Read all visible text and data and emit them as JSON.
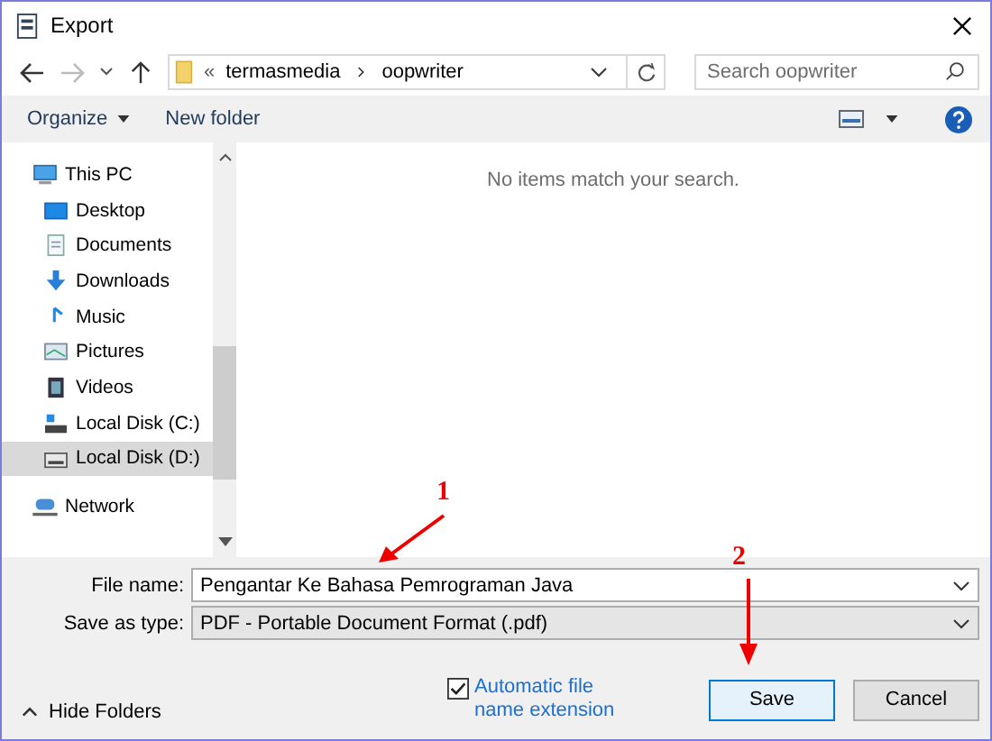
{
  "window": {
    "title": "Export"
  },
  "address": {
    "overflow": "«",
    "path": [
      "termasmedia",
      "oopwriter"
    ]
  },
  "search": {
    "placeholder": "Search oopwriter"
  },
  "toolbar": {
    "organize": "Organize",
    "new_folder": "New folder"
  },
  "sidebar": {
    "items": [
      {
        "label": "This PC",
        "selected": false,
        "children": [
          {
            "label": "Desktop",
            "selected": false
          },
          {
            "label": "Documents",
            "selected": false
          },
          {
            "label": "Downloads",
            "selected": false
          },
          {
            "label": "Music",
            "selected": false
          },
          {
            "label": "Pictures",
            "selected": false
          },
          {
            "label": "Videos",
            "selected": false
          },
          {
            "label": "Local Disk (C:)",
            "selected": false
          },
          {
            "label": "Local Disk (D:)",
            "selected": true
          }
        ]
      },
      {
        "label": "Network",
        "selected": false
      }
    ]
  },
  "content": {
    "empty_message": "No items match your search."
  },
  "form": {
    "file_name_label": "File name:",
    "file_name": "Pengantar Ke Bahasa Pemrograman Java",
    "type_label": "Save as type:",
    "type": "PDF - Portable Document Format (.pdf)"
  },
  "auto_extension": {
    "label": "Automatic file name extension",
    "checked": true
  },
  "hide_folders": "Hide Folders",
  "buttons": [
    {
      "label": "Save",
      "default": true
    },
    {
      "label": "Cancel",
      "default": false
    }
  ],
  "annotations": [
    {
      "number": "1"
    },
    {
      "number": "2"
    }
  ]
}
